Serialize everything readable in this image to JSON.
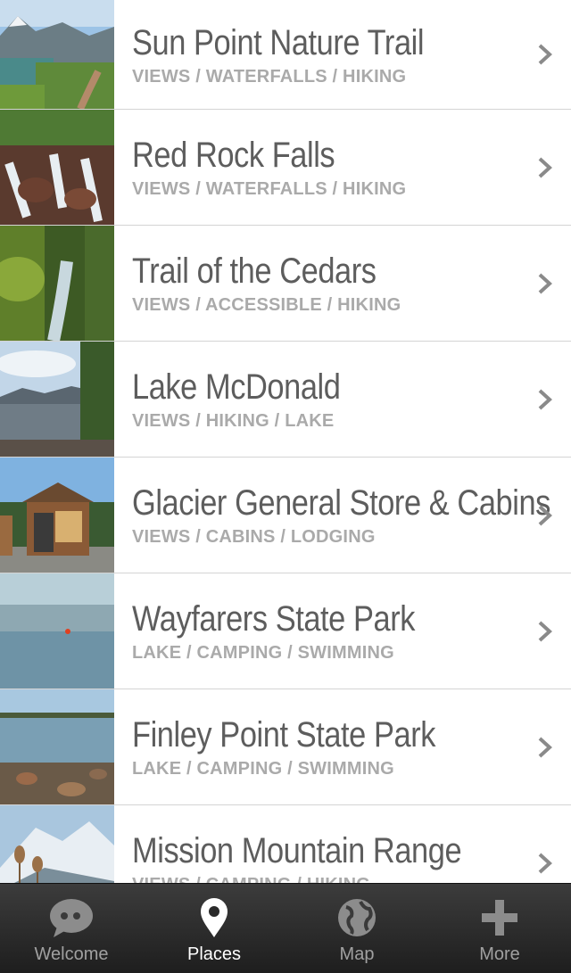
{
  "places": [
    {
      "title": "Sun Point Nature Trail",
      "tags": "VIEWS / WATERFALLS / HIKING"
    },
    {
      "title": "Red Rock Falls",
      "tags": "VIEWS / WATERFALLS / HIKING"
    },
    {
      "title": "Trail of the Cedars",
      "tags": "VIEWS / ACCESSIBLE / HIKING"
    },
    {
      "title": "Lake McDonald",
      "tags": "VIEWS / HIKING / LAKE"
    },
    {
      "title": "Glacier General Store & Cabins",
      "tags": "VIEWS / CABINS / LODGING"
    },
    {
      "title": "Wayfarers State Park",
      "tags": "LAKE / CAMPING / SWIMMING"
    },
    {
      "title": "Finley Point State Park",
      "tags": "LAKE / CAMPING / SWIMMING"
    },
    {
      "title": "Mission Mountain Range",
      "tags": "VIEWS / CAMPING / HIKING"
    }
  ],
  "tabbar": {
    "tabs": [
      {
        "label": "Welcome",
        "icon": "chat-bubble-icon",
        "active": false
      },
      {
        "label": "Places",
        "icon": "map-pin-icon",
        "active": true
      },
      {
        "label": "Map",
        "icon": "globe-icon",
        "active": false
      },
      {
        "label": "More",
        "icon": "plus-icon",
        "active": false
      }
    ]
  },
  "colors": {
    "title": "#5d5d5d",
    "tags": "#aaaaaa",
    "tabbar_bg": "#2b2b2b",
    "tab_active": "#ffffff",
    "tab_inactive": "#a0a0a0"
  }
}
